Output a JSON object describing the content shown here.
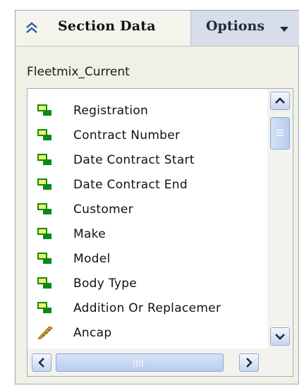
{
  "header": {
    "title": "Section Data",
    "options_label": "Options",
    "collapse_icon": "double-chevron-up-icon",
    "options_icon": "caret-down-icon"
  },
  "source": {
    "name": "Fleetmix_Current"
  },
  "fields": [
    {
      "label": "Registration",
      "icon": "dimension-icon"
    },
    {
      "label": "Contract Number",
      "icon": "dimension-icon"
    },
    {
      "label": "Date Contract Start",
      "icon": "dimension-icon"
    },
    {
      "label": "Date Contract End",
      "icon": "dimension-icon"
    },
    {
      "label": "Customer",
      "icon": "dimension-icon"
    },
    {
      "label": "Make",
      "icon": "dimension-icon"
    },
    {
      "label": "Model",
      "icon": "dimension-icon"
    },
    {
      "label": "Body Type",
      "icon": "dimension-icon"
    },
    {
      "label": "Addition Or Replacemer",
      "icon": "dimension-icon"
    },
    {
      "label": "Ancap",
      "icon": "measure-icon"
    }
  ],
  "colors": {
    "dimension_green": "#0c8a18",
    "dimension_yellow": "#f4f15a",
    "measure_gold": "#d9a21a",
    "accent_blue": "#2f57a8"
  }
}
